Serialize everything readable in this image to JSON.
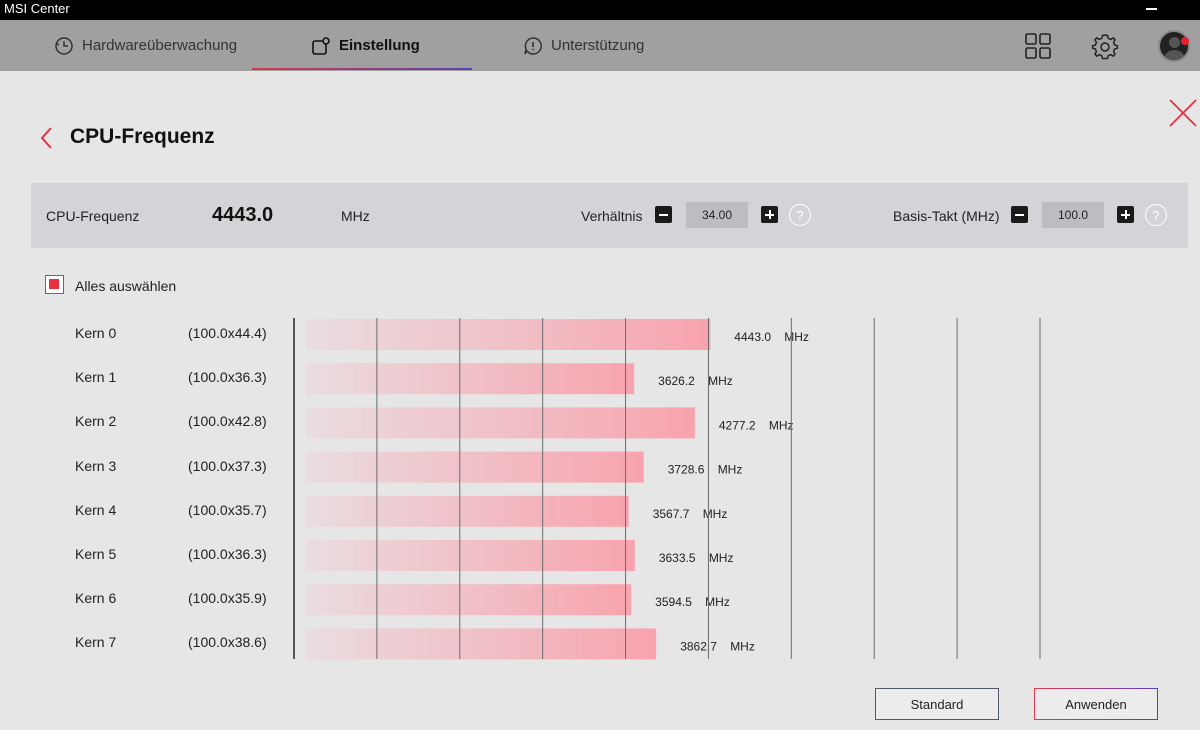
{
  "window": {
    "title": "MSI Center"
  },
  "nav": {
    "tabs": [
      {
        "label": "Hardwareüberwachung",
        "icon": "gauge-icon"
      },
      {
        "label": "Einstellung",
        "icon": "settings-tab-icon"
      },
      {
        "label": "Unterstützung",
        "icon": "support-chat-icon"
      }
    ],
    "active_tab": "Einstellung",
    "right_icons": [
      "grid-icon",
      "gear-icon",
      "avatar"
    ]
  },
  "page": {
    "title": "CPU-Frequenz"
  },
  "info": {
    "freq_label": "CPU-Frequenz",
    "freq_value": "4443.0",
    "freq_unit": "MHz",
    "ratio_label": "Verhältnis",
    "ratio_value": "34.00",
    "base_label": "Basis-Takt (MHz)",
    "base_value": "100.0",
    "help_glyph": "?"
  },
  "select_all": {
    "label": "Alles auswählen",
    "checked": true
  },
  "colors": {
    "accent": "#e8303f",
    "bar_end": "#f8a3ae",
    "bar_start": "#e9dde0"
  },
  "cores": [
    {
      "label": "Kern 0",
      "multiplier": "(100.0x44.4)",
      "freq": "4443.0",
      "unit": "MHz"
    },
    {
      "label": "Kern 1",
      "multiplier": "(100.0x36.3)",
      "freq": "3626.2",
      "unit": "MHz"
    },
    {
      "label": "Kern 2",
      "multiplier": "(100.0x42.8)",
      "freq": "4277.2",
      "unit": "MHz"
    },
    {
      "label": "Kern 3",
      "multiplier": "(100.0x37.3)",
      "freq": "3728.6",
      "unit": "MHz"
    },
    {
      "label": "Kern 4",
      "multiplier": "(100.0x35.7)",
      "freq": "3567.7",
      "unit": "MHz"
    },
    {
      "label": "Kern 5",
      "multiplier": "(100.0x36.3)",
      "freq": "3633.5",
      "unit": "MHz"
    },
    {
      "label": "Kern 6",
      "multiplier": "(100.0x35.9)",
      "freq": "3594.5",
      "unit": "MHz"
    },
    {
      "label": "Kern 7",
      "multiplier": "(100.0x38.6)",
      "freq": "3862.7",
      "unit": "MHz"
    }
  ],
  "chart_data": {
    "type": "bar",
    "orientation": "horizontal",
    "categories": [
      "Kern 0",
      "Kern 1",
      "Kern 2",
      "Kern 3",
      "Kern 4",
      "Kern 5",
      "Kern 6",
      "Kern 7"
    ],
    "values": [
      4443.0,
      3626.2,
      4277.2,
      3728.6,
      3567.7,
      3633.5,
      3594.5,
      3862.7
    ],
    "unit": "MHz",
    "xlim": [
      0,
      8000
    ],
    "grid": true
  },
  "buttons": {
    "standard": "Standard",
    "apply": "Anwenden"
  }
}
